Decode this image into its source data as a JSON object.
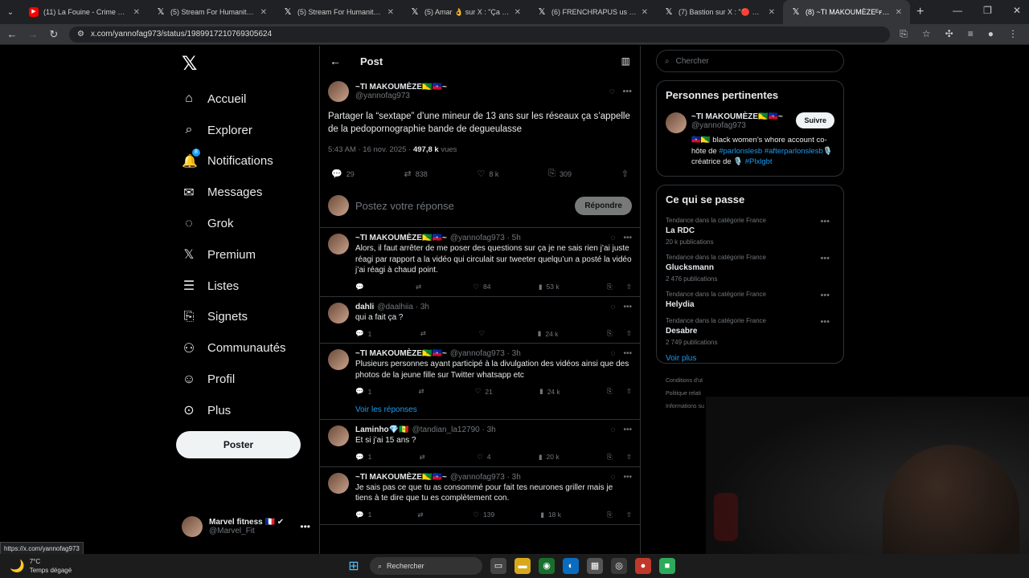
{
  "browser": {
    "tabs": [
      {
        "title": "(11) La Fouine - Crime Session",
        "icon": "youtube-icon",
        "active": false
      },
      {
        "title": "(5) Stream For Humanity Clips",
        "icon": "x-icon",
        "active": false
      },
      {
        "title": "(5) Stream For Humanity Clips",
        "icon": "x-icon",
        "active": false
      },
      {
        "title": "(5) Amar 👌 sur X : \"Ça fait de",
        "icon": "x-icon",
        "active": false
      },
      {
        "title": "(6) FRENCHRAPUS us sur X : \"",
        "icon": "x-icon",
        "active": false
      },
      {
        "title": "(7) Bastion sur X : \"🔴 FR FLASH",
        "icon": "x-icon",
        "active": false
      },
      {
        "title": "(8) ~TI MAKOUMÈZEᴱꜰʜᴛ~ sur",
        "icon": "x-icon",
        "active": true
      }
    ],
    "url": "x.com/yannofag973/status/1989917210769305624"
  },
  "nav": {
    "logo": "𝕏",
    "items": [
      {
        "label": "Accueil",
        "icon": "⌂",
        "name": "home"
      },
      {
        "label": "Explorer",
        "icon": "⌕",
        "name": "explore"
      },
      {
        "label": "Notifications",
        "icon": "🔔",
        "name": "notifications",
        "badge": "8"
      },
      {
        "label": "Messages",
        "icon": "✉",
        "name": "messages"
      },
      {
        "label": "Grok",
        "icon": "◌",
        "name": "grok"
      },
      {
        "label": "Premium",
        "icon": "𝕏",
        "name": "premium"
      },
      {
        "label": "Listes",
        "icon": "☰",
        "name": "lists"
      },
      {
        "label": "Signets",
        "icon": "⎘",
        "name": "bookmarks"
      },
      {
        "label": "Communautés",
        "icon": "⚇",
        "name": "communities"
      },
      {
        "label": "Profil",
        "icon": "☺",
        "name": "profile"
      },
      {
        "label": "Plus",
        "icon": "⊙",
        "name": "more"
      }
    ],
    "post_button": "Poster",
    "account": {
      "name": "Marvel fitness 🇫🇷 ✔",
      "handle": "@Marvel_Fit"
    }
  },
  "center": {
    "header_title": "Post",
    "main": {
      "name": "~TI MAKOUMÈZE🇬🇫🇭🇹~",
      "handle": "@yannofag973",
      "text": "Partager la “sextape” d’une mineur de 13 ans sur les réseaux ça s’appelle de la pedopornographie bande de degueulasse",
      "time": "5:43 AM · 16 nov. 2025 · ",
      "views": "497,8 k",
      "views_label": " vues",
      "replies": "29",
      "retweets": "838",
      "likes": "8 k",
      "bookmarks": "309"
    },
    "reply_placeholder": "Postez votre réponse",
    "reply_button": "Répondre",
    "replies": [
      {
        "name": "~TI MAKOUMÈZE🇬🇫🇭🇹~",
        "handle": "@yannofag973 · 5h",
        "text": "Alors, il faut arrêter de me poser des questions sur ça je ne sais rien j’ai juste réagi par rapport a  la vidéo qui circulait sur tweeter quelqu’un a posté la vidéo j’ai réagi à chaud point.",
        "reply": "",
        "rt": "",
        "like": "84",
        "views": "53 k"
      },
      {
        "name": "dahli",
        "handle": "@daalhiia · 3h",
        "text": "qui a fait ça ?",
        "reply": "1",
        "rt": "",
        "like": "",
        "views": "24 k"
      },
      {
        "name": "~TI MAKOUMÈZE🇬🇫🇭🇹~",
        "handle": "@yannofag973 · 3h",
        "text": "Plusieurs personnes ayant participé à la divulgation des vidéos ainsi que des photos de la jeune fille sur Twitter whatsapp etc",
        "reply": "1",
        "rt": "",
        "like": "21",
        "views": "24 k",
        "see_replies": "Voir les réponses"
      },
      {
        "name": "Laminho💎🇸🇳",
        "handle": "@tandian_la12790 · 3h",
        "text": "Et si j’ai 15 ans ?",
        "reply": "1",
        "rt": "",
        "like": "4",
        "views": "20 k"
      },
      {
        "name": "~TI MAKOUMÈZE🇬🇫🇭🇹~",
        "handle": "@yannofag973 · 3h",
        "text": "Je sais pas ce que tu as consommé pour fait tes neurones griller mais je tiens à te dire que tu es complètement con.",
        "reply": "1",
        "rt": "",
        "like": "139",
        "views": "18 k"
      }
    ]
  },
  "right": {
    "search_placeholder": "Chercher",
    "people_title": "Personnes pertinentes",
    "person": {
      "name": "~TI MAKOUMÈZE🇬🇫🇭🇹~",
      "handle": "@yannofag973",
      "follow": "Suivre",
      "bio_1": "🇭🇹🇬🇫 black women’s whore account co-hôte de ",
      "bio_tag1": "#parlonslesb",
      "bio_tag2": "#afterparlonslesb",
      "bio_2": "🎙️ créatrice de 🎙️ ",
      "bio_tag3": "#Plxlgbt"
    },
    "trends_title": "Ce qui se passe",
    "trends": [
      {
        "cat": "Tendance dans la catégorie France",
        "name": "La RDC",
        "count": "20 k publications"
      },
      {
        "cat": "Tendance dans la catégorie France",
        "name": "Glucksmann",
        "count": "2 476 publications"
      },
      {
        "cat": "Tendance dans la catégorie France",
        "name": "Helydia",
        "count": ""
      },
      {
        "cat": "Tendance dans la catégorie France",
        "name": "Desabre",
        "count": "2 749 publications"
      }
    ],
    "see_more": "Voir plus",
    "footer": [
      "Conditions d'ut",
      "Politique relati",
      "Informations su"
    ]
  },
  "status_tip": "https://x.com/yannofag973",
  "taskbar": {
    "temp": "7°C",
    "weather": "Temps dégagé",
    "search": "Rechercher"
  }
}
